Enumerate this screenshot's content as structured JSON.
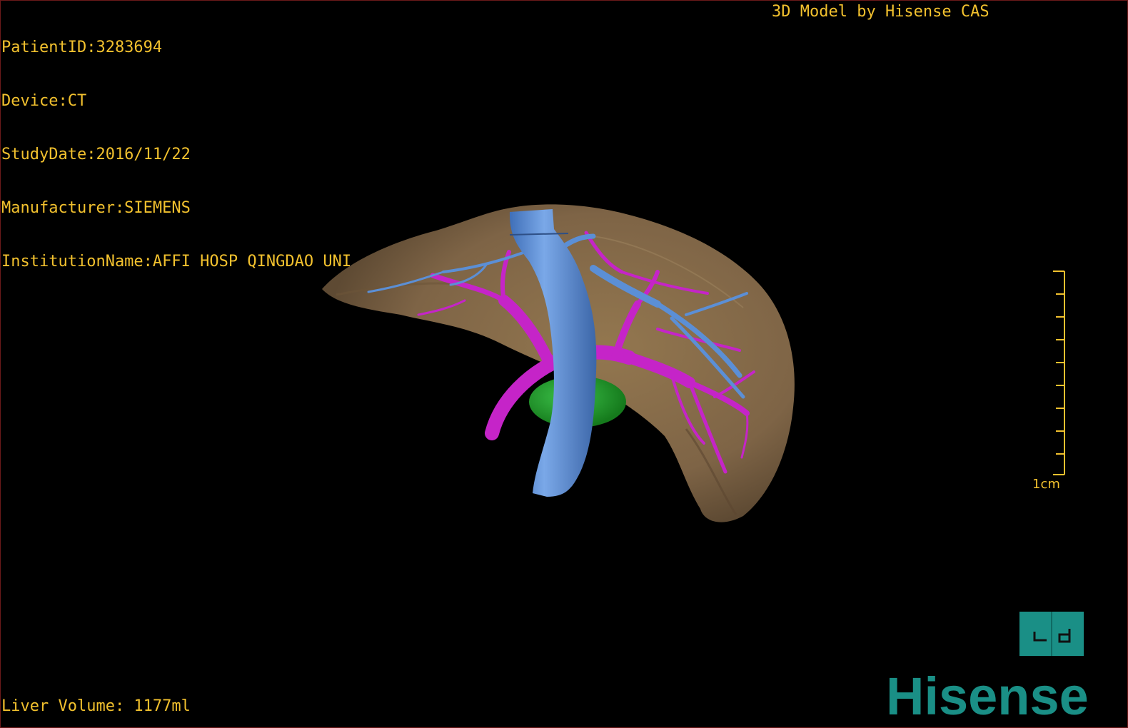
{
  "header": {
    "patient_id": "PatientID:3283694",
    "device": "Device:CT",
    "study_date": "StudyDate:2016/11/22",
    "manufacturer": "Manufacturer:SIEMENS",
    "institution": "InstitutionName:AFFI HOSP QINGDAO UNI"
  },
  "credit": "3D Model by Hisense CAS",
  "footer": {
    "liver_volume": "Liver Volume: 1177ml"
  },
  "scale_bar": {
    "label": "1cm"
  },
  "orientation_cube": {
    "icon": "orientation-cube-icon"
  },
  "logo": {
    "text": "Hisense"
  },
  "colors": {
    "overlay_text": "#f2c12e",
    "liver": "#8a6d4b",
    "portal_vein": "#c524c8",
    "hepatic_vein": "#5b8fd6",
    "gallbladder": "#1f9a2a",
    "brand": "#1a8f86"
  }
}
